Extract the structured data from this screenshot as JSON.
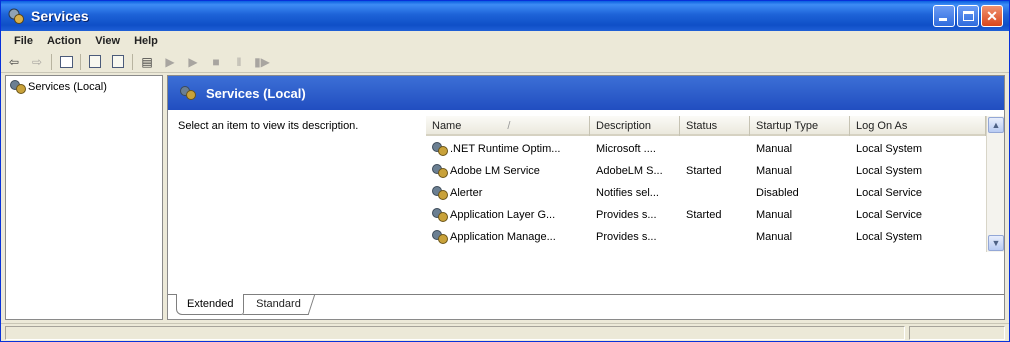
{
  "window": {
    "title": "Services",
    "title_icon": "services-gear-icon"
  },
  "menu": [
    "File",
    "Action",
    "View",
    "Help"
  ],
  "toolbar": {
    "icons": [
      "back-arrow-icon",
      "forward-arrow-icon",
      "up-folder-icon",
      "properties-icon",
      "export-list-icon",
      "help-icon",
      "play-icon",
      "play-icon",
      "stop-icon",
      "pause-icon",
      "restart-icon"
    ]
  },
  "tree": {
    "root_label": "Services (Local)"
  },
  "main": {
    "header_title": "Services (Local)",
    "description_hint": "Select an item to view its description."
  },
  "list": {
    "columns": [
      "Name",
      "Description",
      "Status",
      "Startup Type",
      "Log On As"
    ],
    "sort_indicator": "/",
    "rows": [
      {
        "name": ".NET Runtime Optim...",
        "description": "Microsoft ....",
        "status": "",
        "startup": "Manual",
        "logon": "Local System"
      },
      {
        "name": "Adobe LM Service",
        "description": "AdobeLM S...",
        "status": "Started",
        "startup": "Manual",
        "logon": "Local System"
      },
      {
        "name": "Alerter",
        "description": "Notifies sel...",
        "status": "",
        "startup": "Disabled",
        "logon": "Local Service"
      },
      {
        "name": "Application Layer G...",
        "description": "Provides s...",
        "status": "Started",
        "startup": "Manual",
        "logon": "Local Service"
      },
      {
        "name": "Application Manage...",
        "description": "Provides s...",
        "status": "",
        "startup": "Manual",
        "logon": "Local System"
      }
    ]
  },
  "tabs": {
    "extended": "Extended",
    "standard": "Standard"
  },
  "colors": {
    "titlebar": "#0a5fe0",
    "panel_header": "#214ec0",
    "close_button": "#d8461c"
  }
}
